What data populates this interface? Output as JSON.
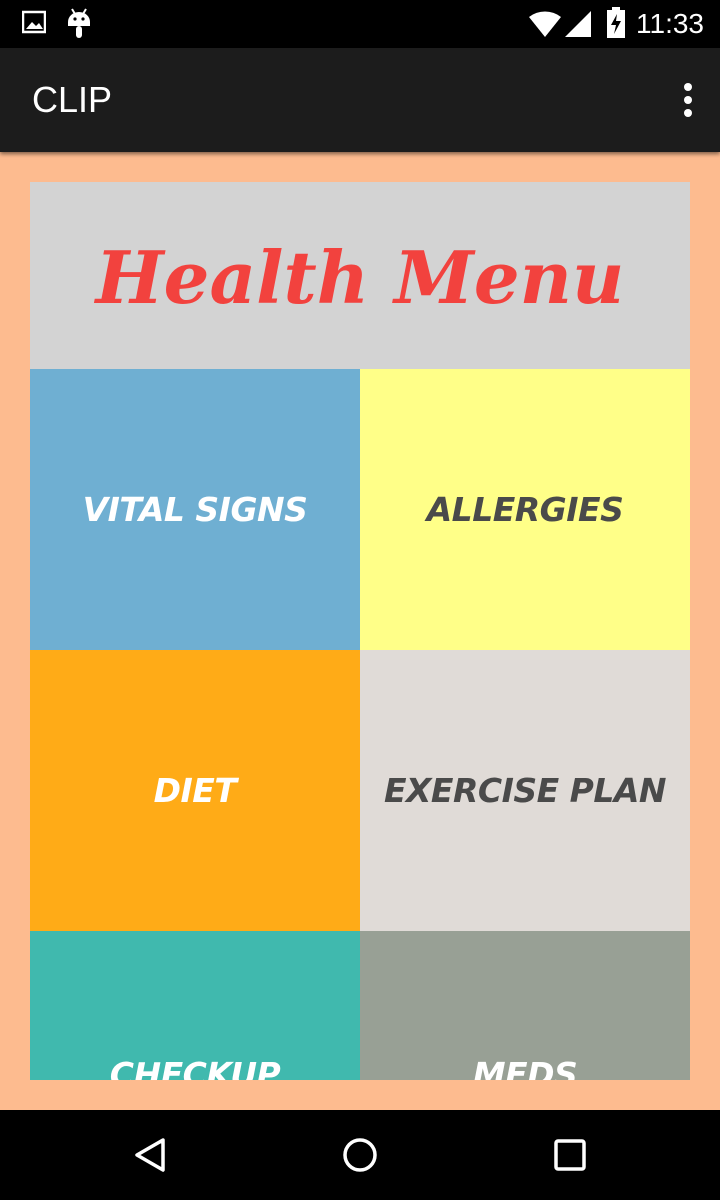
{
  "status_bar": {
    "time": "11:33",
    "icons": [
      "image-icon",
      "android-icon",
      "wifi-icon",
      "signal-icon",
      "battery-charging-icon"
    ]
  },
  "app_bar": {
    "title": "CLIP",
    "menu_icon": "overflow-menu-icon"
  },
  "colors": {
    "background": "#fdbb8f",
    "header_bg": "#d3d3d3",
    "header_text": "#f2423e"
  },
  "health_menu": {
    "title": "Health Menu",
    "tiles": [
      {
        "label": "VITAL SIGNS",
        "bg": "#6fafd2",
        "text_color": "#ffffff"
      },
      {
        "label": "ALLERGIES",
        "bg": "#ffff88",
        "text_color": "#4a4a4a"
      },
      {
        "label": "DIET",
        "bg": "#ffab17",
        "text_color": "#ffffff"
      },
      {
        "label": "EXERCISE PLAN",
        "bg": "#e0dbd7",
        "text_color": "#4a4a4a"
      },
      {
        "label": "CHECKUP",
        "bg": "#40b9ae",
        "text_color": "#ffffff"
      },
      {
        "label": "MEDS",
        "bg": "#98a095",
        "text_color": "#ffffff"
      }
    ]
  },
  "nav_bar": {
    "buttons": [
      "back-icon",
      "home-icon",
      "recents-icon"
    ]
  }
}
